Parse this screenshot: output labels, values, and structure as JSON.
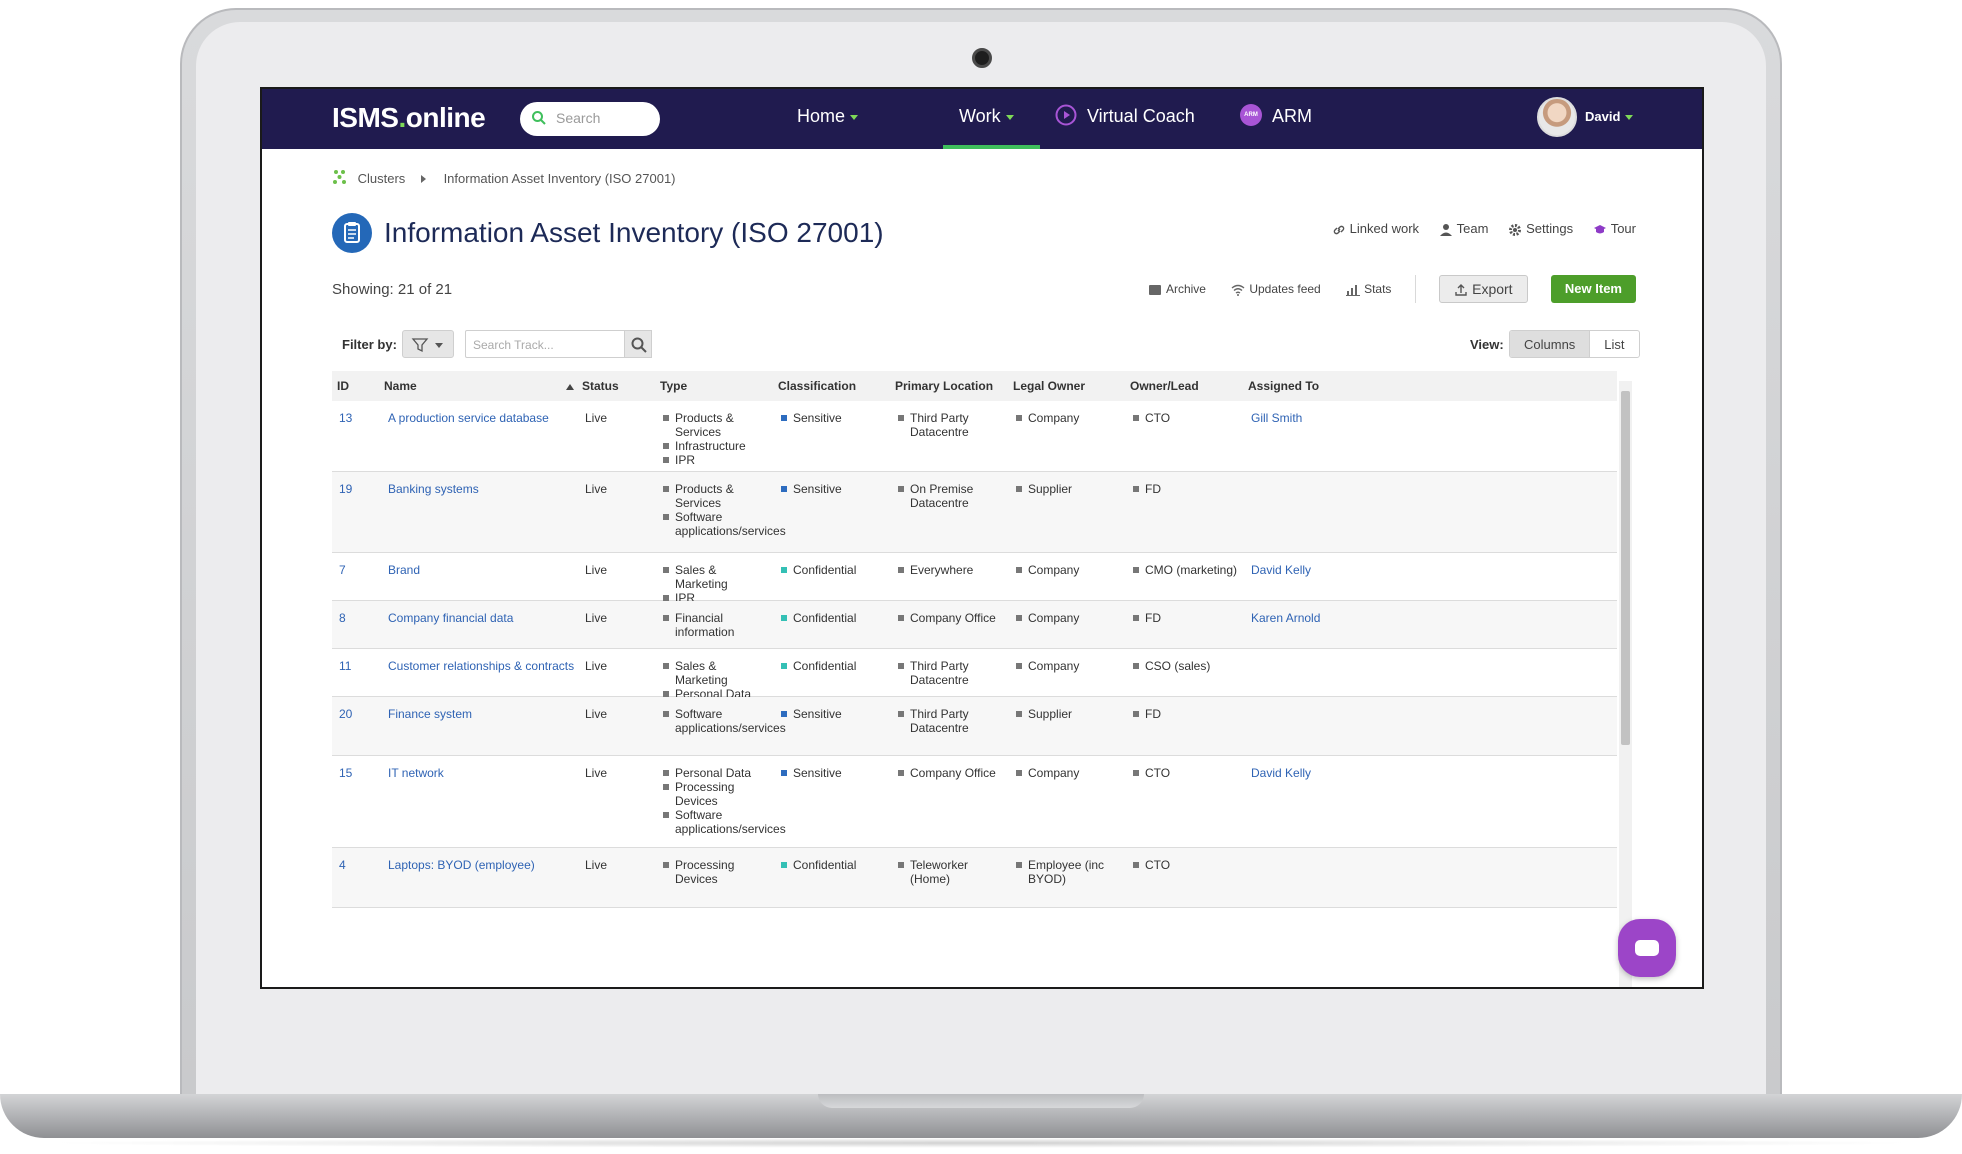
{
  "nav": {
    "logo_main": "ISMS",
    "logo_dot": ".",
    "logo_suffix": "online",
    "search_placeholder": "Search",
    "items": [
      {
        "label": "Home"
      },
      {
        "label": "Work"
      },
      {
        "label": "Virtual Coach"
      },
      {
        "label": "ARM"
      }
    ],
    "arm_badge": "ARM",
    "user_name": "David",
    "accent_color": "#7ed957",
    "bar_color": "#201b4f"
  },
  "breadcrumb": {
    "root": "Clusters",
    "current": "Information Asset Inventory (ISO 27001)"
  },
  "page": {
    "title": "Information Asset Inventory (ISO 27001)",
    "links": [
      "Linked work",
      "Team",
      "Settings",
      "Tour"
    ],
    "showing": "Showing: 21 of 21",
    "actions": {
      "archive": "Archive",
      "updates": "Updates feed",
      "stats": "Stats",
      "export": "Export",
      "new_item": "New Item"
    }
  },
  "filter": {
    "label": "Filter by:",
    "search_placeholder": "Search Track...",
    "view_label": "View:",
    "view_options": [
      "Columns",
      "List"
    ]
  },
  "table": {
    "headers": [
      "ID",
      "Name",
      "Status",
      "Type",
      "Classification",
      "Primary Location",
      "Legal Owner",
      "Owner/Lead",
      "Assigned To"
    ],
    "rows": [
      {
        "id": "13",
        "name": "A production service database",
        "status": "Live",
        "type": [
          "Products & Services",
          "Infrastructure",
          "IPR"
        ],
        "classification": "Sensitive",
        "location": "Third Party Datacentre",
        "legal_owner": "Company",
        "owner_lead": "CTO",
        "assigned": "Gill Smith"
      },
      {
        "id": "19",
        "name": "Banking systems",
        "status": "Live",
        "type": [
          "Products & Services",
          "Software applications/services"
        ],
        "classification": "Sensitive",
        "location": "On Premise Datacentre",
        "legal_owner": "Supplier",
        "owner_lead": "FD",
        "assigned": ""
      },
      {
        "id": "7",
        "name": "Brand",
        "status": "Live",
        "type": [
          "Sales & Marketing",
          "IPR"
        ],
        "classification": "Confidential",
        "location": "Everywhere",
        "legal_owner": "Company",
        "owner_lead": "CMO (marketing)",
        "assigned": "David Kelly"
      },
      {
        "id": "8",
        "name": "Company financial data",
        "status": "Live",
        "type": [
          "Financial information"
        ],
        "classification": "Confidential",
        "location": "Company Office",
        "legal_owner": "Company",
        "owner_lead": "FD",
        "assigned": "Karen Arnold"
      },
      {
        "id": "11",
        "name": "Customer relationships & contracts",
        "status": "Live",
        "type": [
          "Sales & Marketing",
          "Personal Data"
        ],
        "classification": "Confidential",
        "location": "Third Party Datacentre",
        "legal_owner": "Company",
        "owner_lead": "CSO (sales)",
        "assigned": ""
      },
      {
        "id": "20",
        "name": "Finance system",
        "status": "Live",
        "type": [
          "Software applications/services"
        ],
        "classification": "Sensitive",
        "location": "Third Party Datacentre",
        "legal_owner": "Supplier",
        "owner_lead": "FD",
        "assigned": ""
      },
      {
        "id": "15",
        "name": "IT network",
        "status": "Live",
        "type": [
          "Personal Data",
          "Processing Devices",
          "Software applications/services"
        ],
        "classification": "Sensitive",
        "location": "Company Office",
        "legal_owner": "Company",
        "owner_lead": "CTO",
        "assigned": "David Kelly"
      },
      {
        "id": "4",
        "name": "Laptops: BYOD (employee)",
        "status": "Live",
        "type": [
          "Processing Devices"
        ],
        "classification": "Confidential",
        "location": "Teleworker (Home)",
        "legal_owner": "Employee (inc BYOD)",
        "owner_lead": "CTO",
        "assigned": ""
      }
    ]
  }
}
